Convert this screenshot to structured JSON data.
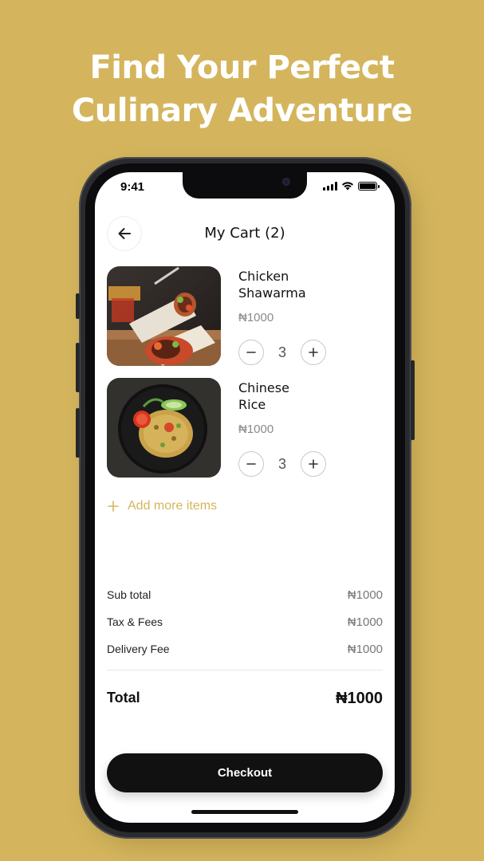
{
  "promo": {
    "headline_line1": "Find Your Perfect",
    "headline_line2": "Culinary Adventure"
  },
  "status_bar": {
    "time": "9:41"
  },
  "header": {
    "title": "My Cart (2)",
    "back_icon": "arrow-left-icon"
  },
  "cart": {
    "items": [
      {
        "name_line1": "Chicken",
        "name_line2": "Shawarma",
        "price": "₦1000",
        "quantity": "3",
        "image": "chicken-shawarma-photo"
      },
      {
        "name_line1": "Chinese",
        "name_line2": "Rice",
        "price": "₦1000",
        "quantity": "3",
        "image": "chinese-rice-photo"
      }
    ],
    "add_more_label": "Add more items"
  },
  "summary": {
    "rows": [
      {
        "label": "Sub total",
        "value": "₦1000"
      },
      {
        "label": "Tax & Fees",
        "value": "₦1000"
      },
      {
        "label": "Delivery Fee",
        "value": "₦1000"
      }
    ],
    "total_label": "Total",
    "total_value": "₦1000"
  },
  "checkout_label": "Checkout",
  "colors": {
    "background": "#d4b55d",
    "accent": "#d4b55d",
    "button": "#111111"
  }
}
